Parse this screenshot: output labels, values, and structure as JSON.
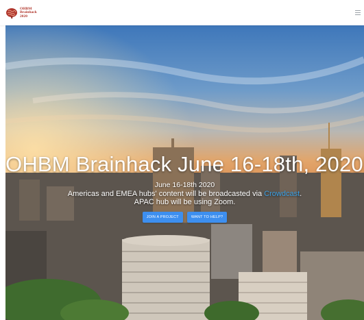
{
  "nav": {
    "brand_lines": [
      "OHBM",
      "Brainhack",
      "2020"
    ],
    "menu_icon": "hamburger-menu-icon",
    "logo_icon": "brain-logo-icon"
  },
  "hero": {
    "headline": "OHBM Brainhack June 16-18th, 2020",
    "cursor": "|",
    "date_line": "June 16-18th 2020",
    "notice_prefix": "Americas and EMEA hubs' content will be broadcasted via ",
    "notice_link": "Crowdcast",
    "notice_suffix": ".",
    "apac_line": "APAC hub will be using Zoom.",
    "buttons": {
      "join": "JOIN A PROJECT",
      "help": "WANT TO HELP?"
    }
  },
  "colors": {
    "accent": "#3d8ff0",
    "link": "#3aa0e6",
    "brand": "#b0362c"
  }
}
